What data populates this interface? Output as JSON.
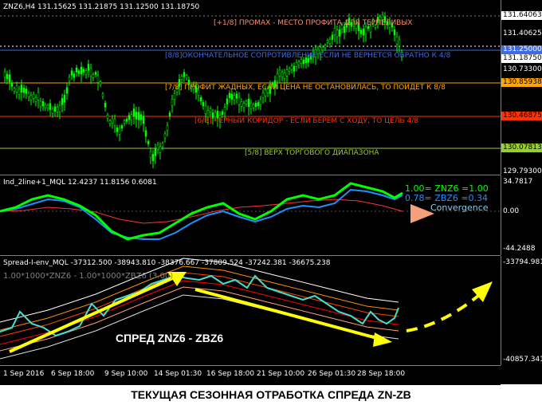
{
  "main_pane": {
    "title": "ZNZ6,H4  131.15625 131.21875 131.12500 131.18750",
    "y_ticks": [
      "131.40625",
      "130.73300",
      "130.07813",
      "129.79300"
    ],
    "price_tags": [
      {
        "label": "131.64063",
        "bg": "#ffffff",
        "fg": "#000000"
      },
      {
        "label": "131.25000",
        "bg": "#4169e1",
        "fg": "#ffffff"
      },
      {
        "label": "131.18750",
        "bg": "#ffffff",
        "fg": "#000000"
      },
      {
        "label": "130.85938",
        "bg": "#ffa500",
        "fg": "#000000"
      },
      {
        "label": "130.46875",
        "bg": "#ff3300",
        "fg": "#000000"
      },
      {
        "label": "130.07813",
        "bg": "#9acd32",
        "fg": "#000000"
      }
    ],
    "levels": [
      {
        "text": "[+1/8] ПРОМАХ - МЕСТО ПРОФИТА ДЛЯ ТЕРПЕЛИВЫХ",
        "color": "#ff8c69"
      },
      {
        "text": "[8/8]ОКОНЧАТЕЛЬНОЕ СОПРОТИВЛЕНИЕ ЕСЛИ НЕ ВЕРНЕТСЯ ОБРАТНО К 4/8",
        "color": "#4169e1"
      },
      {
        "text": "[7/8] ПРОФИТ ЖАДНЫХ, ЕСЛИ ЦЕНА НЕ ОСТАНОВИЛАСЬ, ТО ПОЙДЕТ К 8/8",
        "color": "#ffa500"
      },
      {
        "text": "[6/8] ЧЕРНЫЙ КОРИДОР - ЕСЛИ БЕРЕМ С ХОДУ, ТО ЦЕЛЬ 4/8",
        "color": "#ff3300"
      },
      {
        "text": "[5/8] ВЕРХ ТОРГОВОГО ДИАПАЗОНА",
        "color": "#9acd32"
      }
    ],
    "candle_color": "#00ff00"
  },
  "indicator_pane": {
    "title": "Ind_2line+1_MQL 12.4237 11.8156 0.6081",
    "y_ticks": [
      "34.7817",
      "0.00",
      "-44.2488"
    ],
    "legend": [
      {
        "text": "1.00= ZNZ6 =1.00",
        "color": "#00ff00"
      },
      {
        "text": "0.78= ZBZ6 =0.34",
        "color": "#1e90ff"
      },
      {
        "text": "Convergence",
        "color": "#87ceeb"
      }
    ],
    "line1_color": "#00ff00",
    "line2_color": "#1e90ff",
    "line3_color": "#ff3333",
    "arrow_color": "#f4a07a"
  },
  "spread_pane": {
    "title": "Spread-I-env_MQL -37312.500 -38943.810 -38376.667 -37809.524 -37242.381 -36675.238",
    "formula": "1.00*1000*ZNZ6 - 1.00*1000*ZBZ6 (3.00)",
    "annotation": "СПРЕД  ZNZ6 - ZBZ6",
    "y_ticks": [
      "-33794.981",
      "-40857.341"
    ],
    "spread_color": "#40e0d0",
    "arrow_color": "#ffff00"
  },
  "x_axis": {
    "ticks": [
      "1 Sep 2016",
      "6 Sep 18:00",
      "9 Sep 10:00",
      "14 Sep 01:30",
      "16 Sep 18:00",
      "21 Sep 10:00",
      "26 Sep 01:30",
      "28 Sep 18:00"
    ]
  },
  "caption": "ТЕКУЩАЯ СЕЗОННАЯ ОТРАБОТКА СПРЕДА  ZN-ZB"
}
